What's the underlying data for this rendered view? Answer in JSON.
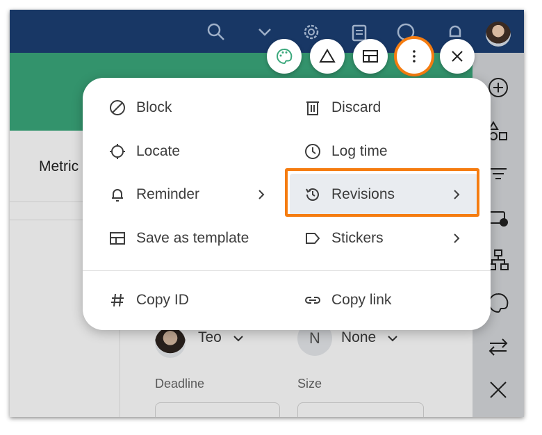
{
  "main": {
    "tab_label": "Metric"
  },
  "toolbar": {
    "buttons": [
      {
        "icon": "palette-icon"
      },
      {
        "icon": "triangle-icon"
      },
      {
        "icon": "layout-icon"
      },
      {
        "icon": "more-vertical-icon",
        "highlighted": true
      },
      {
        "icon": "close-icon"
      }
    ]
  },
  "menu": {
    "items": [
      {
        "label": "Block",
        "icon": "block-icon"
      },
      {
        "label": "Discard",
        "icon": "trash-icon"
      },
      {
        "label": "Locate",
        "icon": "crosshair-icon"
      },
      {
        "label": "Log time",
        "icon": "clock-icon"
      },
      {
        "label": "Reminder",
        "icon": "bell-icon",
        "submenu": true
      },
      {
        "label": "Revisions",
        "icon": "history-icon",
        "submenu": true,
        "highlighted": true
      },
      {
        "label": "Save as template",
        "icon": "template-icon"
      },
      {
        "label": "Stickers",
        "icon": "tag-icon",
        "submenu": true
      },
      {
        "label": "Copy ID",
        "icon": "hash-icon"
      },
      {
        "label": "Copy link",
        "icon": "link-icon"
      }
    ]
  },
  "fields": {
    "assignee": "Teo",
    "priority_avatar": "N",
    "priority": "None",
    "deadline_label": "Deadline",
    "size_label": "Size"
  },
  "colors": {
    "header": "#183765",
    "accent_green": "#3ba87c",
    "highlight": "#f57c10"
  }
}
